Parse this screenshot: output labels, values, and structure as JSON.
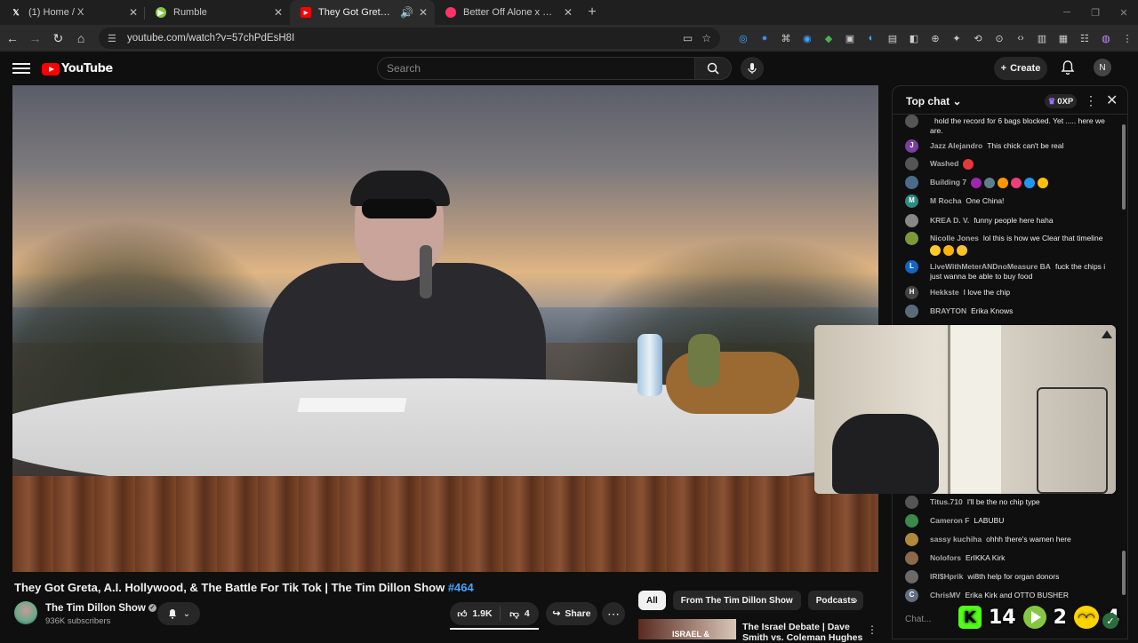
{
  "browser": {
    "tabs": [
      {
        "title": "(1) Home / X",
        "icon": "x-logo-icon",
        "color": "#ffffff"
      },
      {
        "title": "Rumble",
        "icon": "rumble-logo-icon",
        "color": "#85c742"
      },
      {
        "title": "They Got Greta, A.I. Hollywood",
        "icon": "youtube-logo-icon",
        "color": "#ff0000",
        "active": true
      },
      {
        "title": "Better Off Alone x Clarity (agai",
        "icon": "music-icon",
        "color": "#ff3366"
      }
    ],
    "new_tab": "+",
    "url": "youtube.com/watch?v=57chPdEsH8I"
  },
  "youtube": {
    "logo_text": "YouTube",
    "search_placeholder": "Search",
    "create_label": "Create",
    "avatar_initial": "N"
  },
  "video": {
    "title": "They Got Greta, A.I. Hollywood, & The Battle For Tik Tok | The Tim Dillon Show",
    "hashtag": "#464",
    "channel": "The Tim Dillon Show",
    "subscribers": "936K subscribers",
    "likes": "1.9K",
    "dislikes": "4",
    "share_label": "Share"
  },
  "filters": {
    "chips": [
      "All",
      "From The Tim Dillon Show",
      "Podcasts"
    ],
    "selected": "All"
  },
  "recommended": {
    "thumb_text": "ISRAEL &",
    "title": "The Israel Debate | Dave Smith vs. Coleman Hughes"
  },
  "chat": {
    "header": "Top chat",
    "xp": "0XP",
    "input_placeholder": "Chat...",
    "messages": [
      {
        "name": "",
        "text": "hold the record for 6 bags blocked. Yet ..... here we are.",
        "initial": "",
        "color": "#555555"
      },
      {
        "name": "Jazz Alejandro",
        "text": "This chick can't be real",
        "initial": "J",
        "color": "#7b3fa0"
      },
      {
        "name": "Washed",
        "text": "",
        "initial": "",
        "color": "#555555"
      },
      {
        "name": "Building 7",
        "text": "",
        "initial": "",
        "color": "#4a6b8a"
      },
      {
        "name": "M Rocha",
        "text": "One China!",
        "initial": "M",
        "color": "#2e8b82"
      },
      {
        "name": "KREA D. V.",
        "text": "funny people here haha",
        "initial": "",
        "color": "#888888"
      },
      {
        "name": "Nicolle Jones",
        "text": "lol this is how we Clear that timeline",
        "initial": "",
        "color": "#7a9a3a"
      },
      {
        "name": "LiveWithMeterANDnoMeasure BA",
        "text": "fuck the chips i just wanna be able to buy food",
        "initial": "L",
        "color": "#1565c0"
      },
      {
        "name": "Hekkste",
        "text": "I love the chip",
        "initial": "H",
        "color": "#444444"
      },
      {
        "name": "BRAYTON",
        "text": "Erika Knows",
        "initial": "",
        "color": "#5a6a7a"
      },
      {
        "name": "Titus.710",
        "text": "I'll be the no chip type",
        "initial": "",
        "color": "#555555"
      },
      {
        "name": "Cameron F",
        "text": "LABUBU",
        "initial": "",
        "color": "#3a8a4a"
      },
      {
        "name": "sassy kuchiha",
        "text": "ohhh there's wamen here",
        "initial": "",
        "color": "#b08a3a"
      },
      {
        "name": "Nolofors",
        "text": "ErIKKA Kirk",
        "initial": "",
        "color": "#8a6a4a"
      },
      {
        "name": "IRI$Hprik",
        "text": "wi8th help for organ donors",
        "initial": "",
        "color": "#6a6a6a"
      },
      {
        "name": "ChrisMV",
        "text": "Erika Kirk and OTTO BUSHER",
        "initial": "C",
        "color": "#607080"
      }
    ]
  },
  "stream_stats": {
    "kick_count": "14",
    "rumble_count": "2",
    "other_count": "4"
  }
}
